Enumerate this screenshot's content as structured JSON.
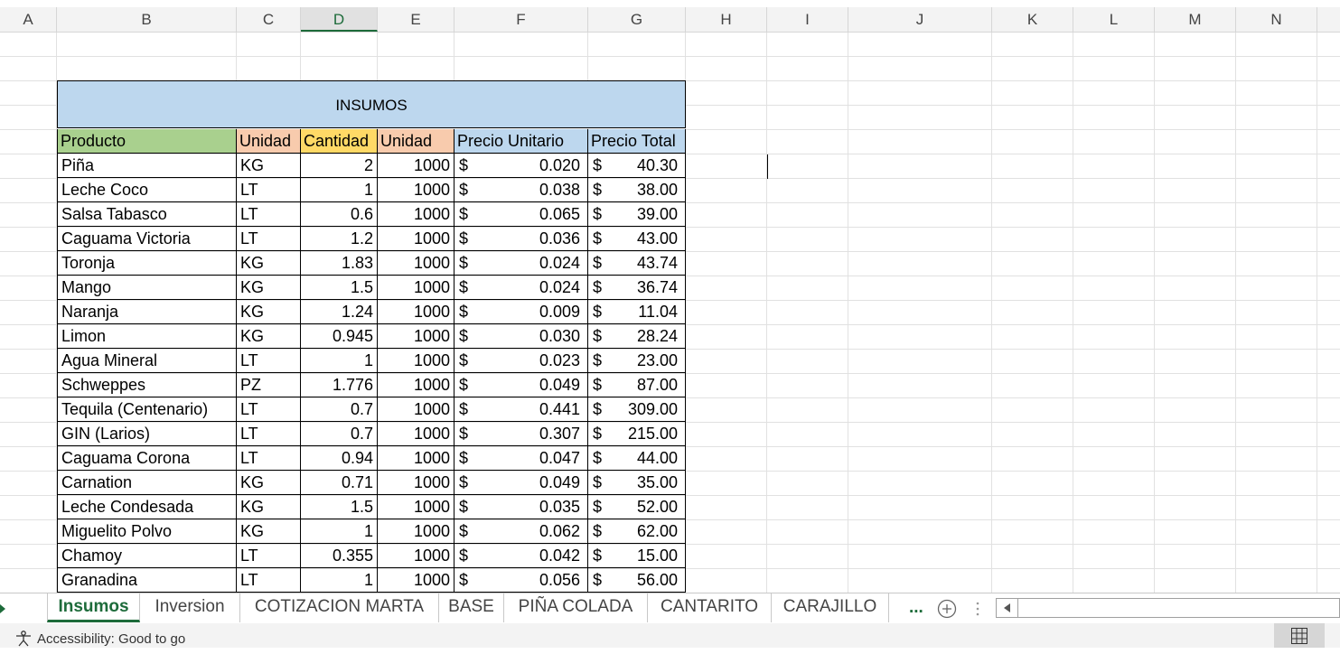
{
  "columns": [
    "A",
    "B",
    "C",
    "D",
    "E",
    "F",
    "G",
    "H",
    "I",
    "J",
    "K",
    "L",
    "M",
    "N"
  ],
  "active_column": "D",
  "table": {
    "title": "INSUMOS",
    "headers": [
      "Producto",
      "Unidad",
      "Cantidad",
      "Unidad",
      "Precio Unitario",
      "Precio Total"
    ],
    "currency": "$",
    "rows": [
      [
        "Piña",
        "KG",
        "2",
        "1000",
        "0.020",
        "40.30"
      ],
      [
        "Leche Coco",
        "LT",
        "1",
        "1000",
        "0.038",
        "38.00"
      ],
      [
        "Salsa Tabasco",
        "LT",
        "0.6",
        "1000",
        "0.065",
        "39.00"
      ],
      [
        "Caguama Victoria",
        "LT",
        "1.2",
        "1000",
        "0.036",
        "43.00"
      ],
      [
        "Toronja",
        "KG",
        "1.83",
        "1000",
        "0.024",
        "43.74"
      ],
      [
        "Mango",
        "KG",
        "1.5",
        "1000",
        "0.024",
        "36.74"
      ],
      [
        "Naranja",
        "KG",
        "1.24",
        "1000",
        "0.009",
        "11.04"
      ],
      [
        "Limon",
        "KG",
        "0.945",
        "1000",
        "0.030",
        "28.24"
      ],
      [
        "Agua Mineral",
        "LT",
        "1",
        "1000",
        "0.023",
        "23.00"
      ],
      [
        "Schweppes",
        "PZ",
        "1.776",
        "1000",
        "0.049",
        "87.00"
      ],
      [
        "Tequila (Centenario)",
        "LT",
        "0.7",
        "1000",
        "0.441",
        "309.00"
      ],
      [
        "GIN (Larios)",
        "LT",
        "0.7",
        "1000",
        "0.307",
        "215.00"
      ],
      [
        "Caguama Corona",
        "LT",
        "0.94",
        "1000",
        "0.047",
        "44.00"
      ],
      [
        "Carnation",
        "KG",
        "0.71",
        "1000",
        "0.049",
        "35.00"
      ],
      [
        "Leche Condesada",
        "KG",
        "1.5",
        "1000",
        "0.035",
        "52.00"
      ],
      [
        "Miguelito Polvo",
        "KG",
        "1",
        "1000",
        "0.062",
        "62.00"
      ],
      [
        "Chamoy",
        "LT",
        "0.355",
        "1000",
        "0.042",
        "15.00"
      ],
      [
        "Granadina",
        "LT",
        "1",
        "1000",
        "0.056",
        "56.00"
      ]
    ]
  },
  "sheet_tabs": [
    "Insumos",
    "Inversion",
    "COTIZACION MARTA",
    "BASE",
    "PIÑA COLADA",
    "CANTARITO",
    "CARAJILLO"
  ],
  "active_tab": "Insumos",
  "more_tabs_label": "...",
  "status": {
    "accessibility": "Accessibility: Good to go"
  },
  "icons": {
    "add_sheet": "plus-circle-icon",
    "scroll_left": "triangle-left-icon",
    "accessibility": "person-icon",
    "normal_view": "grid-icon"
  },
  "colors": {
    "accent": "#1d6b3a",
    "title_fill": "#bdd7ee",
    "producto_fill": "#a9d08e",
    "unidad_fill": "#f8cbad",
    "cantidad_fill": "#ffd966",
    "precio_fill": "#bdd7ee"
  }
}
